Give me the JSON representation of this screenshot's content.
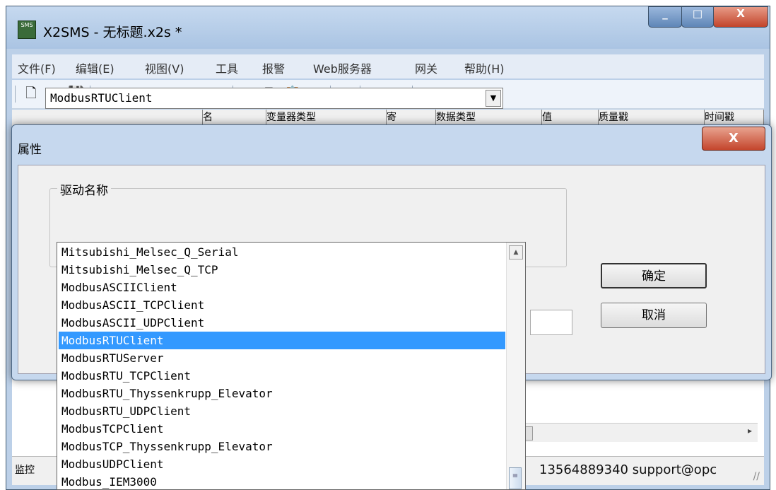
{
  "app": {
    "title": "X2SMS - 无标题.x2s *",
    "icon_label": "SMS",
    "window_buttons": {
      "minimize": "_",
      "maximize": "□",
      "close": "X"
    }
  },
  "menu": {
    "items": [
      "文件(F)",
      "编辑(E)",
      "视图(V)",
      "工具",
      "报警",
      "Web服务器",
      "网关",
      "帮助(H)"
    ]
  },
  "toolbar": {
    "icons": [
      "new-file-icon",
      "open-folder-icon",
      "save-icon",
      "database-icon",
      "plug-icon",
      "table-icon",
      "device-icon",
      "module-icon",
      "properties-icon",
      "cut-icon",
      "copy-icon",
      "paste-icon",
      "delete-icon",
      "run-config-icon",
      "play-icon",
      "stop-icon",
      "tools-icon",
      "load-icon",
      "upload-icon"
    ],
    "glyphs": [
      "🗋",
      "📂",
      "💾",
      "▦",
      "✎",
      "▤",
      "✧",
      "◈",
      "☰",
      "✂",
      "⎘",
      "📋",
      "✕",
      "⚙",
      "▶",
      "■",
      "⚒",
      "⇊",
      "⇈"
    ]
  },
  "grid": {
    "headers": [
      "",
      "名",
      "变量器类型",
      "寄",
      "数据类型",
      "值",
      "质量戳",
      "时间戳"
    ]
  },
  "dialog": {
    "title": "属性",
    "close": "X",
    "group_label": "驱动名称",
    "combo_value": "ModbusRTUClient",
    "combo_arrow": "▼",
    "ok_label": "确定",
    "cancel_label": "取消"
  },
  "dropdown": {
    "items": [
      "Mitsubishi_Melsec_Q_Serial",
      "Mitsubishi_Melsec_Q_TCP",
      "ModbusASCIIClient",
      "ModbusASCII_TCPClient",
      "ModbusASCII_UDPClient",
      "ModbusRTUClient",
      "ModbusRTUServer",
      "ModbusRTU_TCPClient",
      "ModbusRTU_Thyssenkrupp_Elevator",
      "ModbusRTU_UDPClient",
      "ModbusTCPClient",
      "ModbusTCP_Thyssenkrupp_Elevator",
      "ModbusUDPClient",
      "Modbus_IEM3000"
    ],
    "selected_index": 5,
    "scroll_up": "▲",
    "scroll_thumb": "≡"
  },
  "status": {
    "left": "监控",
    "contact": "13564889340 support@opc",
    "grip": "//",
    "hscroll_arrow": "▸"
  }
}
